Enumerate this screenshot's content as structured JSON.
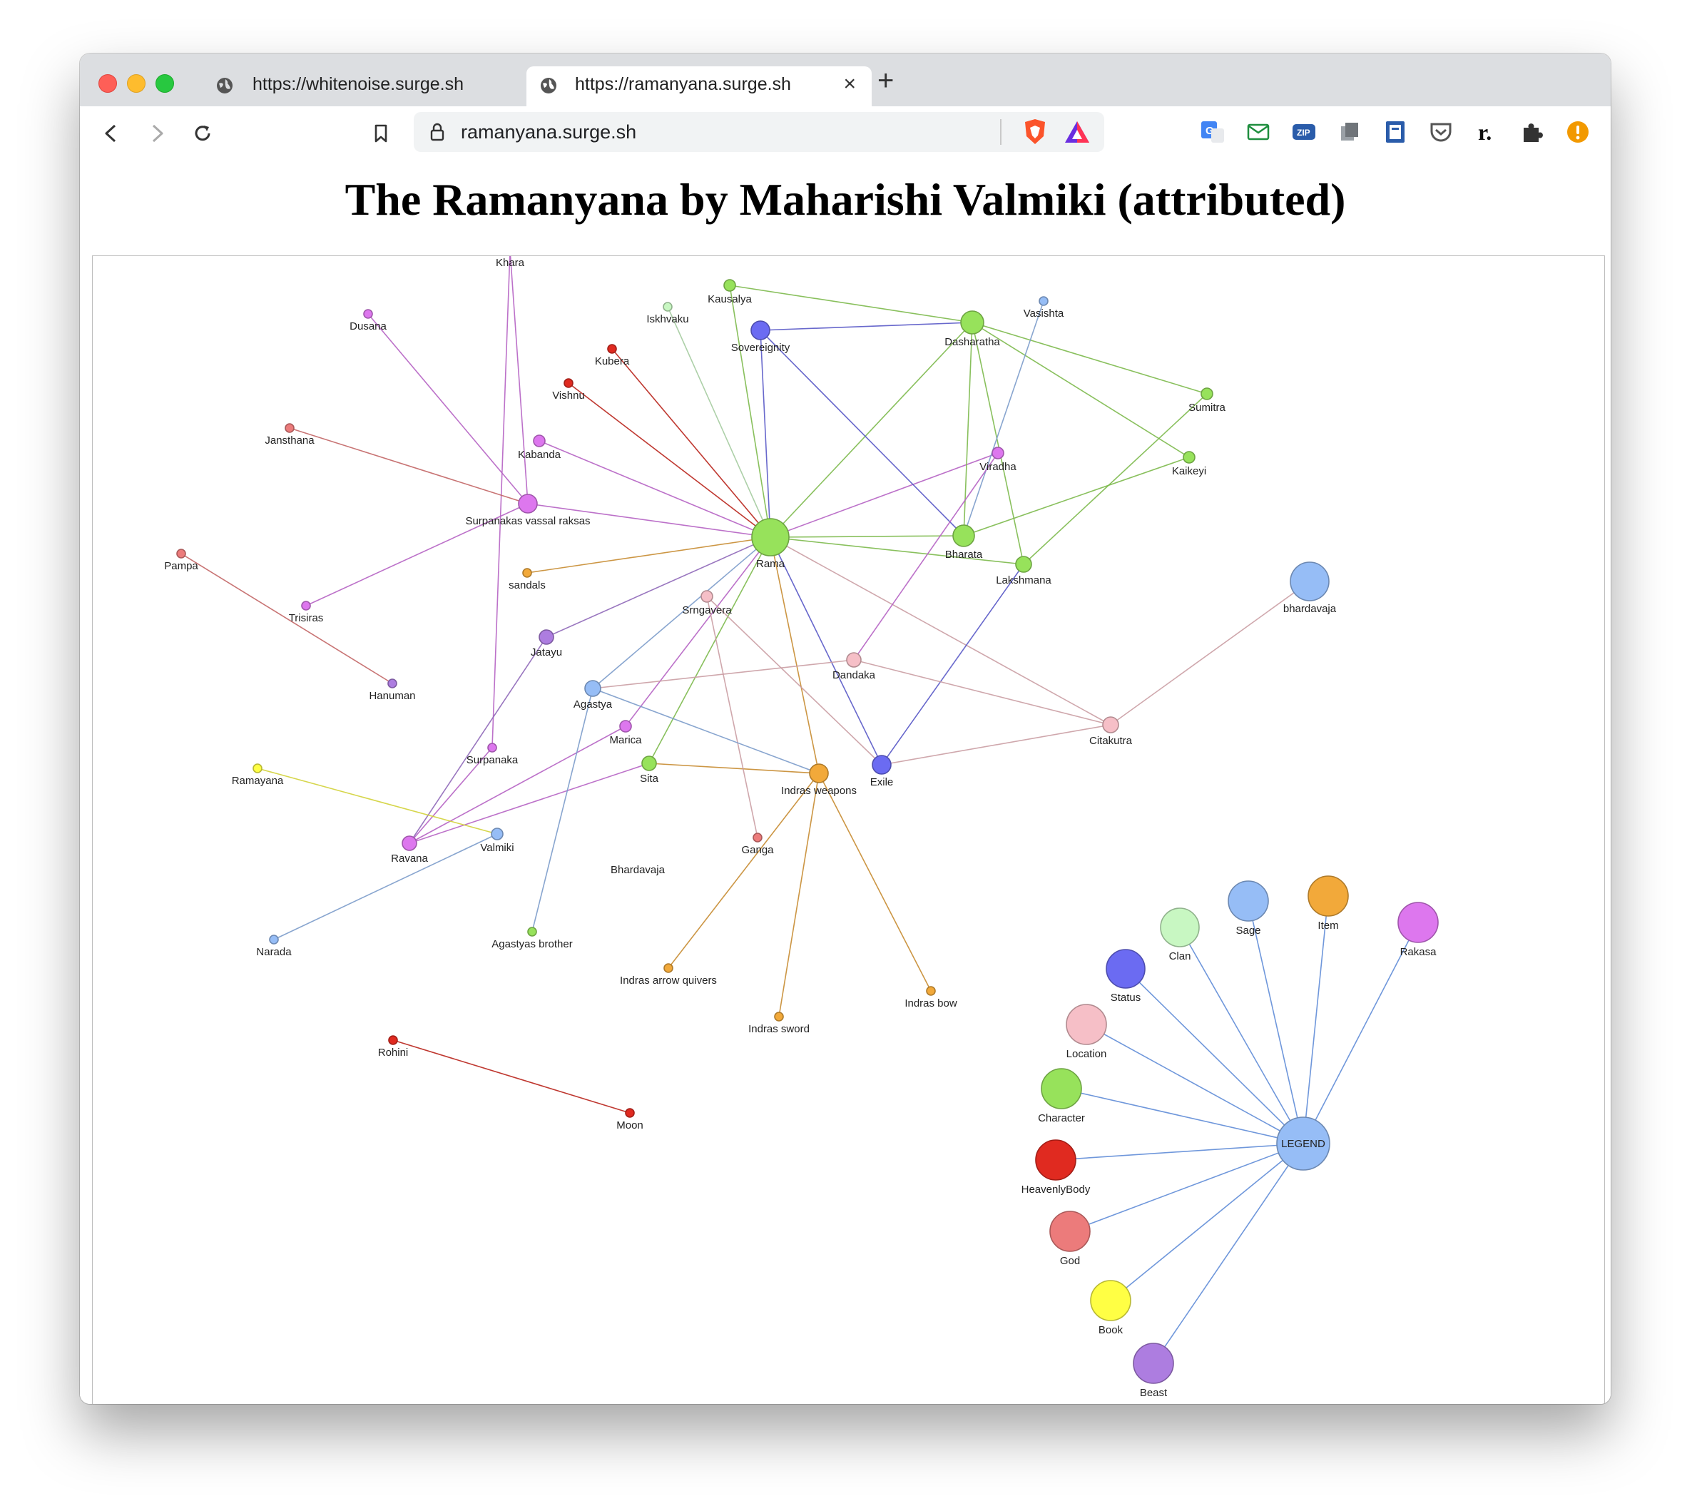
{
  "browser": {
    "tabs": [
      {
        "title": "https://whitenoise.surge.sh",
        "active": false
      },
      {
        "title": "https://ramanyana.surge.sh",
        "active": true
      }
    ],
    "new_tab_label": "+",
    "close_label": "×",
    "address_url": "ramanyana.surge.sh",
    "extensions": [
      {
        "name": "translate-icon",
        "color": "#4285f4"
      },
      {
        "name": "mail-icon",
        "color": "#1e8e3e"
      },
      {
        "name": "zip-icon",
        "color": "#2a5caa",
        "label": "ZIP"
      },
      {
        "name": "copy-icon",
        "color": "#8a8a8a"
      },
      {
        "name": "reader-icon",
        "color": "#2a5caa"
      },
      {
        "name": "pocket-icon",
        "color": "#555555"
      },
      {
        "name": "readwise-icon",
        "color": "#111111",
        "label": "r."
      },
      {
        "name": "puzzle-icon",
        "color": "#333333"
      },
      {
        "name": "alert-icon",
        "color": "#f29900",
        "label": "!"
      }
    ]
  },
  "page": {
    "title": "The Ramanyana by Maharishi Valmiki (attributed)"
  },
  "graph": {
    "type_colors": {
      "Character": "#97e25b",
      "Rakasa": "#dd77ee",
      "Sage": "#96bdf6",
      "Item": "#f2a93a",
      "Clan": "#c8f7c2",
      "Status": "#6b6bf2",
      "Location": "#f6bfc7",
      "HeavenlyBody": "#e02a20",
      "God": "#ec7b7b",
      "Book": "#ffff44",
      "Beast": "#ad7de0"
    },
    "nodes": [
      {
        "label": "Khara",
        "type": "Rakasa"
      },
      {
        "label": "Dusana",
        "type": "Rakasa"
      },
      {
        "label": "Iskhvaku",
        "type": "Clan"
      },
      {
        "label": "Kausalya",
        "type": "Character"
      },
      {
        "label": "Sovereignity",
        "type": "Status"
      },
      {
        "label": "Dasharatha",
        "type": "Character"
      },
      {
        "label": "Vasishta",
        "type": "Sage"
      },
      {
        "label": "Kubera",
        "type": "HeavenlyBody"
      },
      {
        "label": "Vishnu",
        "type": "HeavenlyBody"
      },
      {
        "label": "Sumitra",
        "type": "Character"
      },
      {
        "label": "Jansthana",
        "type": "God"
      },
      {
        "label": "Kabanda",
        "type": "Rakasa"
      },
      {
        "label": "Viradha",
        "type": "Rakasa"
      },
      {
        "label": "Kaikeyi",
        "type": "Character"
      },
      {
        "label": "Surpanakas vassal raksas",
        "type": "Rakasa"
      },
      {
        "label": "Rama",
        "type": "Character"
      },
      {
        "label": "Bharata",
        "type": "Character"
      },
      {
        "label": "Lakshmana",
        "type": "Character"
      },
      {
        "label": "Pampa",
        "type": "God"
      },
      {
        "label": "sandals",
        "type": "Item"
      },
      {
        "label": "Trisiras",
        "type": "Rakasa"
      },
      {
        "label": "Srngavera",
        "type": "Location"
      },
      {
        "label": "bhardavaja",
        "type": "Sage"
      },
      {
        "label": "Jatayu",
        "type": "Beast"
      },
      {
        "label": "Dandaka",
        "type": "Location"
      },
      {
        "label": "Hanuman",
        "type": "Beast"
      },
      {
        "label": "Agastya",
        "type": "Sage"
      },
      {
        "label": "Citakutra",
        "type": "Location"
      },
      {
        "label": "Marica",
        "type": "Rakasa"
      },
      {
        "label": "Surpanaka",
        "type": "Rakasa"
      },
      {
        "label": "Ramayana",
        "type": "Book"
      },
      {
        "label": "Sita",
        "type": "Character"
      },
      {
        "label": "Indras weapons",
        "type": "Item"
      },
      {
        "label": "Exile",
        "type": "Status"
      },
      {
        "label": "Ravana",
        "type": "Rakasa"
      },
      {
        "label": "Valmiki",
        "type": "Sage"
      },
      {
        "label": "Ganga",
        "type": "God"
      },
      {
        "label": "Bhardavaja",
        "type": "Sage"
      },
      {
        "label": "Narada",
        "type": "Sage"
      },
      {
        "label": "Agastyas brother",
        "type": "Character"
      },
      {
        "label": "Indras arrow quivers",
        "type": "Item"
      },
      {
        "label": "Indras bow",
        "type": "Item"
      },
      {
        "label": "Indras sword",
        "type": "Item"
      },
      {
        "label": "Rohini",
        "type": "HeavenlyBody"
      },
      {
        "label": "Moon",
        "type": "HeavenlyBody"
      }
    ],
    "edges": [
      [
        "Rama",
        "Kausalya"
      ],
      [
        "Rama",
        "Sovereignity"
      ],
      [
        "Rama",
        "Iskhvaku"
      ],
      [
        "Rama",
        "Kubera"
      ],
      [
        "Rama",
        "Vishnu"
      ],
      [
        "Rama",
        "Kabanda"
      ],
      [
        "Rama",
        "Surpanakas vassal raksas"
      ],
      [
        "Rama",
        "sandals"
      ],
      [
        "Rama",
        "Dasharatha"
      ],
      [
        "Rama",
        "Viradha"
      ],
      [
        "Rama",
        "Bharata"
      ],
      [
        "Rama",
        "Lakshmana"
      ],
      [
        "Rama",
        "Jatayu"
      ],
      [
        "Rama",
        "Agastya"
      ],
      [
        "Rama",
        "Sita"
      ],
      [
        "Rama",
        "Indras weapons"
      ],
      [
        "Rama",
        "Exile"
      ],
      [
        "Rama",
        "Citakutra"
      ],
      [
        "Rama",
        "Marica"
      ],
      [
        "Kausalya",
        "Dasharatha"
      ],
      [
        "Sovereignity",
        "Dasharatha"
      ],
      [
        "Dasharatha",
        "Sumitra"
      ],
      [
        "Dasharatha",
        "Kaikeyi"
      ],
      [
        "Dasharatha",
        "Bharata"
      ],
      [
        "Dasharatha",
        "Lakshmana"
      ],
      [
        "Sovereignity",
        "Bharata"
      ],
      [
        "Bharata",
        "Kaikeyi"
      ],
      [
        "Lakshmana",
        "Sumitra"
      ],
      [
        "Lakshmana",
        "Exile"
      ],
      [
        "Sita",
        "Indras weapons"
      ],
      [
        "Bharata",
        "Vasishta"
      ],
      [
        "Khara",
        "Surpanakas vassal raksas"
      ],
      [
        "Khara",
        "Surpanaka"
      ],
      [
        "Dusana",
        "Surpanakas vassal raksas"
      ],
      [
        "Jansthana",
        "Surpanakas vassal raksas"
      ],
      [
        "Trisiras",
        "Surpanakas vassal raksas"
      ],
      [
        "Pampa",
        "Hanuman"
      ],
      [
        "Jatayu",
        "Ravana"
      ],
      [
        "Surpanaka",
        "Ravana"
      ],
      [
        "Marica",
        "Ravana"
      ],
      [
        "Sita",
        "Ravana"
      ],
      [
        "Viradha",
        "Dandaka"
      ],
      [
        "Dandaka",
        "Citakutra"
      ],
      [
        "Dandaka",
        "Agastya"
      ],
      [
        "Citakutra",
        "bhardavaja"
      ],
      [
        "Citakutra",
        "Exile"
      ],
      [
        "Srngavera",
        "Exile"
      ],
      [
        "Srngavera",
        "Ganga"
      ],
      [
        "Agastya",
        "Indras weapons"
      ],
      [
        "Agastya",
        "Agastyas brother"
      ],
      [
        "Ramayana",
        "Valmiki"
      ],
      [
        "Valmiki",
        "Narada"
      ],
      [
        "Indras weapons",
        "Indras arrow quivers"
      ],
      [
        "Indras weapons",
        "Indras bow"
      ],
      [
        "Indras weapons",
        "Indras sword"
      ],
      [
        "Rohini",
        "Moon"
      ]
    ],
    "legend": {
      "center_label": "LEGEND",
      "items": [
        "Clan",
        "Sage",
        "Item",
        "Rakasa",
        "Status",
        "Location",
        "Character",
        "HeavenlyBody",
        "God",
        "Book",
        "Beast"
      ]
    }
  }
}
